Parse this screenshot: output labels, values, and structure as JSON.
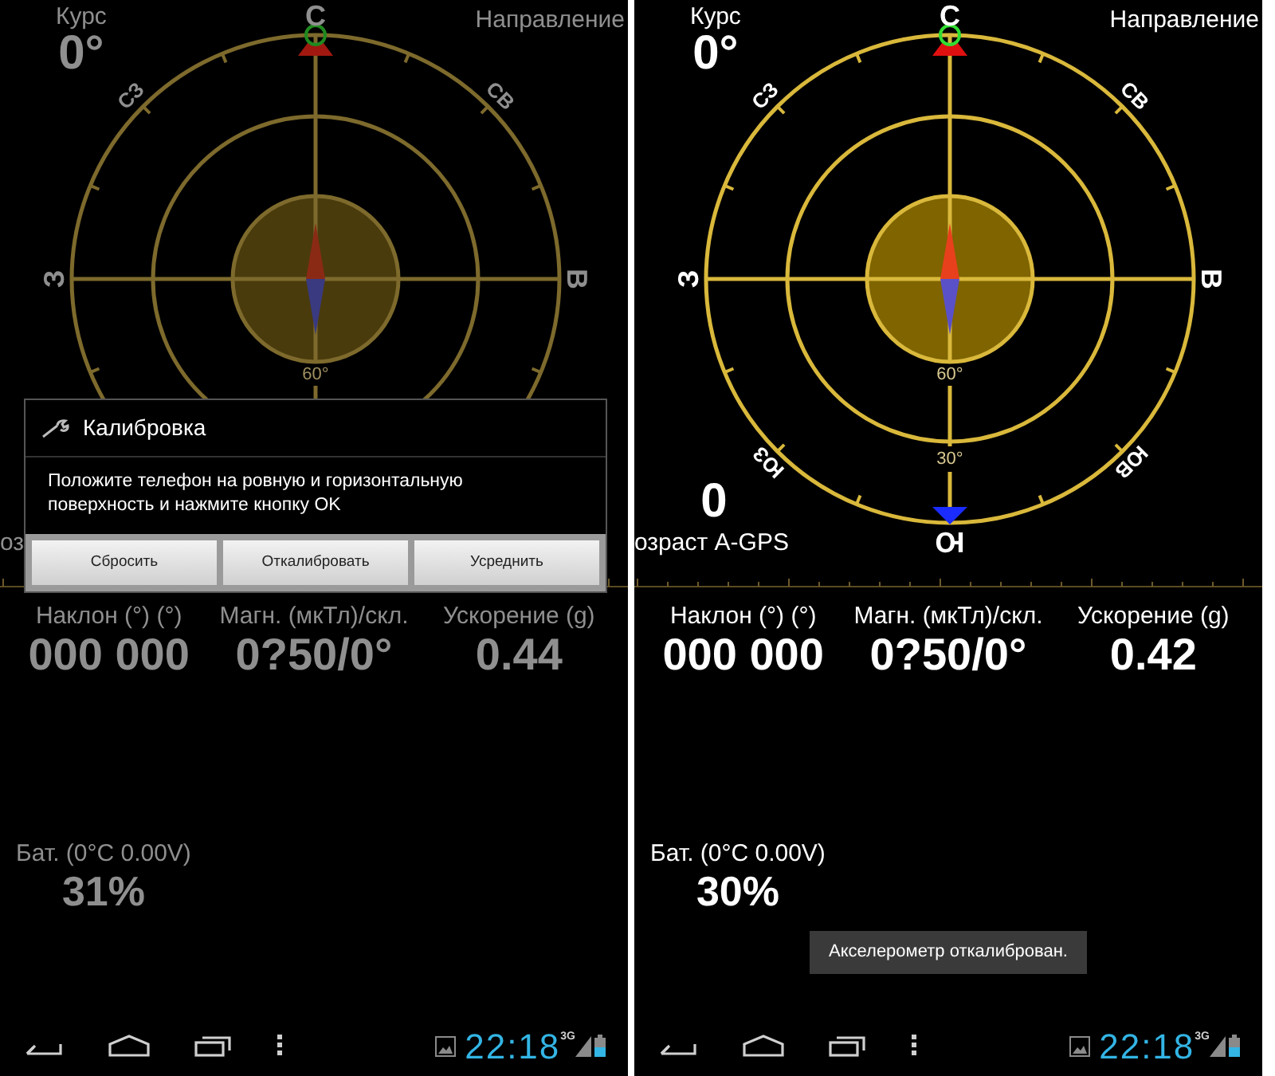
{
  "panels": [
    {
      "dimmed": true,
      "course": {
        "label": "Курс",
        "value": "0°"
      },
      "direction_label": "Направление",
      "compass_labels": [
        {
          "kind": "n",
          "text": "С"
        },
        {
          "kind": "nw",
          "text": "СЗ"
        },
        {
          "kind": "ne",
          "text": "СВ"
        },
        {
          "kind": "w",
          "text": "З"
        },
        {
          "kind": "e",
          "text": "В"
        },
        {
          "kind": "ring60",
          "text": "60°"
        }
      ],
      "gps_age": {
        "label": "оз"
      },
      "stats": [
        {
          "label": "Наклон (°) (°)",
          "value": "000 000"
        },
        {
          "label": "Магн. (мкТл)/скл.",
          "value": "0?50/0°"
        },
        {
          "label": "Ускорение (g)",
          "value": "0.44"
        }
      ],
      "battery": {
        "label": "Бат. (0°C 0.00V)",
        "value": "31%"
      },
      "dialog": {
        "title": "Калибровка",
        "message": "Положите телефон на ровную и горизонтальную поверхность и нажмите кнопку OK",
        "buttons": [
          "Сбросить",
          "Откалибровать",
          "Усреднить"
        ]
      },
      "nav_bar": {
        "time": "22:18",
        "network": "3G"
      }
    },
    {
      "dimmed": false,
      "course": {
        "label": "Курс",
        "value": "0°"
      },
      "direction_label": "Направление",
      "compass_labels": [
        {
          "kind": "n",
          "text": "С"
        },
        {
          "kind": "nw",
          "text": "СЗ"
        },
        {
          "kind": "ne",
          "text": "СВ"
        },
        {
          "kind": "w",
          "text": "З"
        },
        {
          "kind": "e",
          "text": "В"
        },
        {
          "kind": "ring60",
          "text": "60°"
        },
        {
          "kind": "ring30",
          "text": "30°"
        },
        {
          "kind": "sw",
          "text": "ЮЗ"
        },
        {
          "kind": "se",
          "text": "ЮВ"
        },
        {
          "kind": "s",
          "text": "Ю"
        }
      ],
      "gps_age": {
        "value": "0",
        "label": "озраст A-GPS"
      },
      "stats": [
        {
          "label": "Наклон (°) (°)",
          "value": "000 000"
        },
        {
          "label": "Магн. (мкТл)/скл.",
          "value": "0?50/0°"
        },
        {
          "label": "Ускорение (g)",
          "value": "0.42"
        }
      ],
      "battery": {
        "label": "Бат. (0°C 0.00V)",
        "value": "30%"
      },
      "toast": "Акселерометр откалиброван.",
      "nav_bar": {
        "time": "22:18",
        "network": "3G"
      }
    }
  ]
}
